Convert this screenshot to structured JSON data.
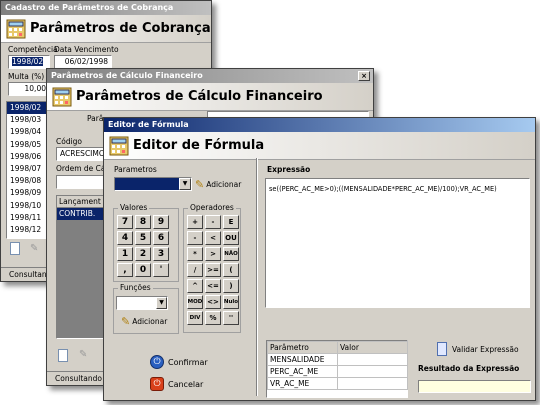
{
  "win1": {
    "title": "Cadastro de Parâmetros de Cobrança",
    "header": "Parâmetros de Cobrança",
    "competencia_label": "Competência",
    "competencia_value": "1998/02",
    "data_venc_label": "Data Vencimento",
    "data_venc_value": "06/02/1998",
    "multa_label": "Multa (%)",
    "multa_value": "10,00",
    "list": [
      "1998/02",
      "1998/03",
      "1998/04",
      "1998/05",
      "1998/06",
      "1998/07",
      "1998/08",
      "1998/09",
      "1998/10",
      "1998/11",
      "1998/12"
    ],
    "status": "Consultando"
  },
  "win2": {
    "title": "Parâmetros de Cálculo Financeiro",
    "header": "Parâmetros de Cálculo Financeiro",
    "param_label": "Parâ",
    "codigo_label": "Código",
    "codigo_value": "ACRESCIMO",
    "ordem_label": "Ordem de Cálc",
    "grid_header": "Lançament",
    "grid_row": "CONTRIB.",
    "status": "Consultando D"
  },
  "win3": {
    "title": "Editor de Fórmula",
    "header": "Editor de Fórmula",
    "parametros_group": "Parametros",
    "adicionar_label": "Adicionar",
    "valores_group": "Valores",
    "operadores_group": "Operadores",
    "funcoes_group": "Funções",
    "keypad": [
      "7",
      "8",
      "9",
      "4",
      "5",
      "6",
      "1",
      "2",
      "3",
      ",",
      "0",
      "'"
    ],
    "operators": [
      "+",
      "-",
      "E",
      "-",
      "<",
      "OU",
      "*",
      ">",
      "NÃO",
      "/",
      ">=",
      "(",
      "^",
      "<=",
      ")",
      "MOD",
      "<>",
      "Nulo",
      "DIV",
      "%",
      "''"
    ],
    "expressao_label": "Expressão",
    "expressao_value": "se((PERC_AC_ME>0);((MENSALIDADE*PERC_AC_ME)/100);VR_AC_ME)",
    "param_table": {
      "columns": [
        "Parâmetro",
        "Valor"
      ],
      "rows": [
        [
          "MENSALIDADE",
          ""
        ],
        [
          "PERC_AC_ME",
          ""
        ],
        [
          "VR_AC_ME",
          ""
        ]
      ]
    },
    "validar_label": "Validar Expressão",
    "resultado_label": "Resultado da Expressão",
    "confirmar_label": "Confirmar",
    "cancelar_label": "Cancelar"
  }
}
